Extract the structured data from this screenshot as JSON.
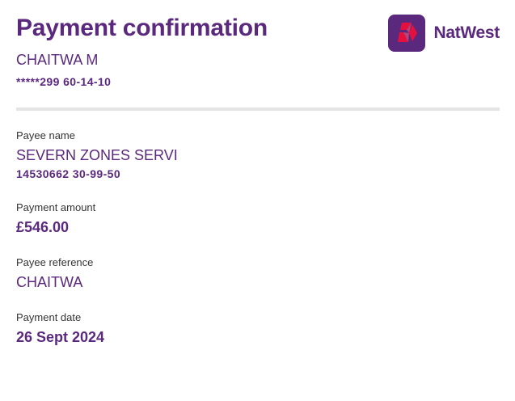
{
  "header": {
    "title": "Payment confirmation",
    "account_name": "CHAITWA M",
    "account_number": "*****299 60-14-10"
  },
  "brand": {
    "name": "NatWest",
    "logo_icon": "natwest-cubes-icon",
    "colors": {
      "brand_purple": "#5a287d",
      "logo_red": "#e5103d"
    }
  },
  "payee": {
    "label": "Payee name",
    "name": "SEVERN ZONES SERVI",
    "account": "14530662 30-99-50"
  },
  "amount": {
    "label": "Payment amount",
    "value": "£546.00"
  },
  "reference": {
    "label": "Payee reference",
    "value": "CHAITWA"
  },
  "date": {
    "label": "Payment date",
    "value": "26 Sept 2024"
  }
}
